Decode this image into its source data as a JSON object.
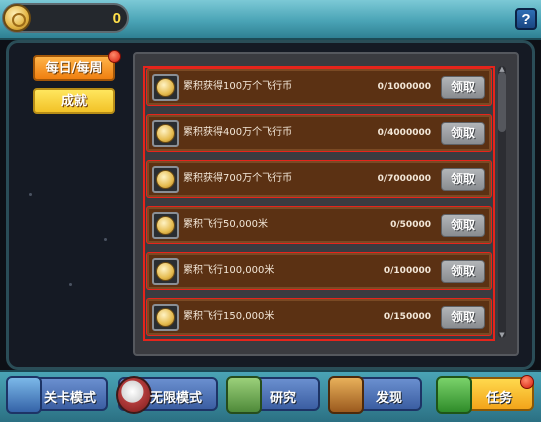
{
  "header": {
    "coin_icon": "coin-icon",
    "coin_count": "0",
    "help_label": "?"
  },
  "tabs": [
    {
      "label": "每日/每周",
      "active": true,
      "has_notification": true
    },
    {
      "label": "成就",
      "active": false
    }
  ],
  "achievements": [
    {
      "icon": "coin-icon",
      "label": "累积获得100万个飞行币",
      "progress": "0/1000000",
      "claim_label": "领取"
    },
    {
      "icon": "coin-icon",
      "label": "累积获得400万个飞行币",
      "progress": "0/4000000",
      "claim_label": "领取"
    },
    {
      "icon": "coin-icon",
      "label": "累积获得700万个飞行币",
      "progress": "0/7000000",
      "claim_label": "领取"
    },
    {
      "icon": "coin-icon",
      "label": "累积飞行50,000米",
      "progress": "0/50000",
      "claim_label": "领取"
    },
    {
      "icon": "coin-icon",
      "label": "累积飞行100,000米",
      "progress": "0/100000",
      "claim_label": "领取"
    },
    {
      "icon": "coin-icon",
      "label": "累积飞行150,000米",
      "progress": "0/150000",
      "claim_label": "领取"
    }
  ],
  "bottom_nav": [
    {
      "label": "关卡模式",
      "icon": "stage-icon"
    },
    {
      "label": "无限模式",
      "icon": "stopwatch-icon"
    },
    {
      "label": "研究",
      "icon": "book-icon"
    },
    {
      "label": "发现",
      "icon": "treasure-chest-icon"
    },
    {
      "label": "任务",
      "icon": "flag-icon",
      "has_notification": true
    }
  ],
  "colors": {
    "highlight": "#e6241b",
    "row_background": "#5b3113",
    "coin_text": "#ffe04a",
    "tab_active": "#ef7f10",
    "tab_inactive": "#f2c227"
  }
}
